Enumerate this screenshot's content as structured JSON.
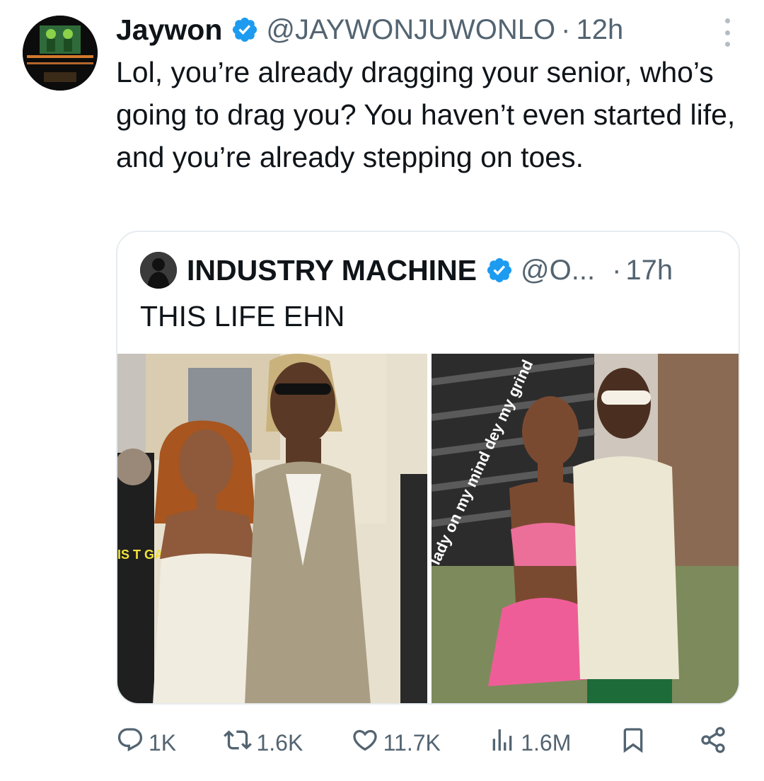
{
  "tweet": {
    "author_name": "Jaywon",
    "author_handle": "@JAYWONJUWONLO",
    "separator": "·",
    "time": "12h",
    "text": "Lol, you’re already dragging your senior, who’s going to drag you? You haven’t even started life, and you’re already stepping on toes."
  },
  "quoted_tweet": {
    "author_name": "INDUSTRY MACHINE",
    "author_handle": "@O...",
    "separator": "·",
    "time": "17h",
    "text": "THIS LIFE EHN",
    "photo_1_sign_text": "IS T GAI",
    "photo_2_wall_text": "lady on my mind dey my grind"
  },
  "actions": {
    "replies": "1K",
    "reposts": "1.6K",
    "likes": "11.7K",
    "views": "1.6M"
  },
  "icons": [
    "verified-badge-icon",
    "more-icon",
    "reply-icon",
    "repost-icon",
    "like-icon",
    "views-icon",
    "bookmark-icon",
    "share-icon"
  ],
  "colors": {
    "verified": "#1d9bf0",
    "secondary_text": "#536471",
    "border": "#e6ecf0"
  }
}
